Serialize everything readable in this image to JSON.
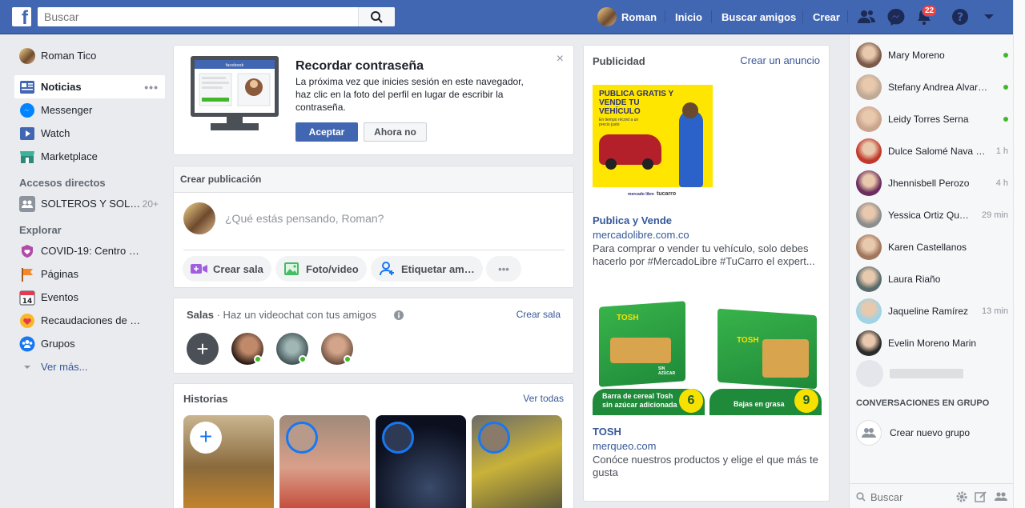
{
  "header": {
    "search_placeholder": "Buscar",
    "user_name": "Roman",
    "nav_home": "Inicio",
    "nav_find_friends": "Buscar amigos",
    "nav_create": "Crear",
    "notifications_count": "22"
  },
  "sidebar": {
    "profile_name": "Roman Tico",
    "news": "Noticias",
    "messenger": "Messenger",
    "watch": "Watch",
    "marketplace": "Marketplace",
    "shortcuts_title": "Accesos directos",
    "shortcut_group": "SOLTEROS Y SOL…",
    "shortcut_count": "20+",
    "explore_title": "Explorar",
    "explore": [
      "COVID-19: Centro …",
      "Páginas",
      "Eventos",
      "Recaudaciones de …",
      "Grupos"
    ],
    "events_day": "14",
    "see_more": "Ver más..."
  },
  "reminder": {
    "title": "Recordar contraseña",
    "body": "La próxima vez que inicies sesión en este navegador, haz clic en la foto del perfil en lugar de escribir la contraseña.",
    "accept": "Aceptar",
    "not_now": "Ahora no",
    "mock_brand": "facebook"
  },
  "composer": {
    "title": "Crear publicación",
    "placeholder": "¿Qué estás pensando, Roman?",
    "create_room": "Crear sala",
    "photo_video": "Foto/video",
    "tag_friends": "Etiquetar am…"
  },
  "rooms": {
    "title": "Salas",
    "subtitle": " · Haz un videochat con tus amigos",
    "create": "Crear sala"
  },
  "stories": {
    "title": "Historias",
    "see_all": "Ver todas"
  },
  "ads": {
    "title": "Publicidad",
    "create_ad": "Crear un anuncio",
    "ad1": {
      "banner_title": "PUBLICA GRATIS Y VENDE TU VEHÍCULO",
      "banner_sub": "En tiempo récord a un precio justo",
      "logo1": "mercado libre",
      "logo2": "tucarro",
      "title": "Publica y Vende",
      "domain": "mercadolibre.com.co",
      "text": "Para comprar o vender tu vehículo, solo debes hacerlo por #MercadoLibre #TuCarro el expert..."
    },
    "ad2": {
      "brand": "TOSH",
      "box1_caption": "Barra de cereal Tosh sin azúcar adicionada",
      "box1_count": "6",
      "box2_caption": "Bajas en grasa",
      "box2_count": "9",
      "box1_flavor": "SIN AZÚCAR",
      "title": "TOSH",
      "domain": "merqueo.com",
      "text": "Conóce nuestros productos y elige el que más te gusta"
    }
  },
  "contacts": [
    {
      "name": "Mary Moreno",
      "time": "",
      "online": true,
      "color": "#7a5a48"
    },
    {
      "name": "Stefany Andrea Alvar…",
      "time": "",
      "online": true,
      "color": "#bfa996"
    },
    {
      "name": "Leidy Torres Serna",
      "time": "",
      "online": true,
      "color": "#c9a48e"
    },
    {
      "name": "Dulce Salomé Nava …",
      "time": "1 h",
      "online": false,
      "color": "#c0392b"
    },
    {
      "name": "Jhennisbell Perozo",
      "time": "4 h",
      "online": false,
      "color": "#6b2d5c"
    },
    {
      "name": "Yessica Ortiz Qu…",
      "time": "29 min",
      "online": false,
      "color": "#8d8d8d"
    },
    {
      "name": "Karen Castellanos",
      "time": "",
      "online": false,
      "color": "#a0765d"
    },
    {
      "name": "Laura Riaño",
      "time": "",
      "online": false,
      "color": "#5a6b6e"
    },
    {
      "name": "Jaqueline Ramírez",
      "time": "13 min",
      "online": false,
      "color": "#9fd3e6"
    },
    {
      "name": "Evelin Moreno Marin",
      "time": "",
      "online": false,
      "color": "#2b2b2b"
    }
  ],
  "group_chats": {
    "title": "CONVERSACIONES EN GRUPO",
    "create": "Crear nuevo grupo"
  },
  "chat_search_placeholder": "Buscar"
}
